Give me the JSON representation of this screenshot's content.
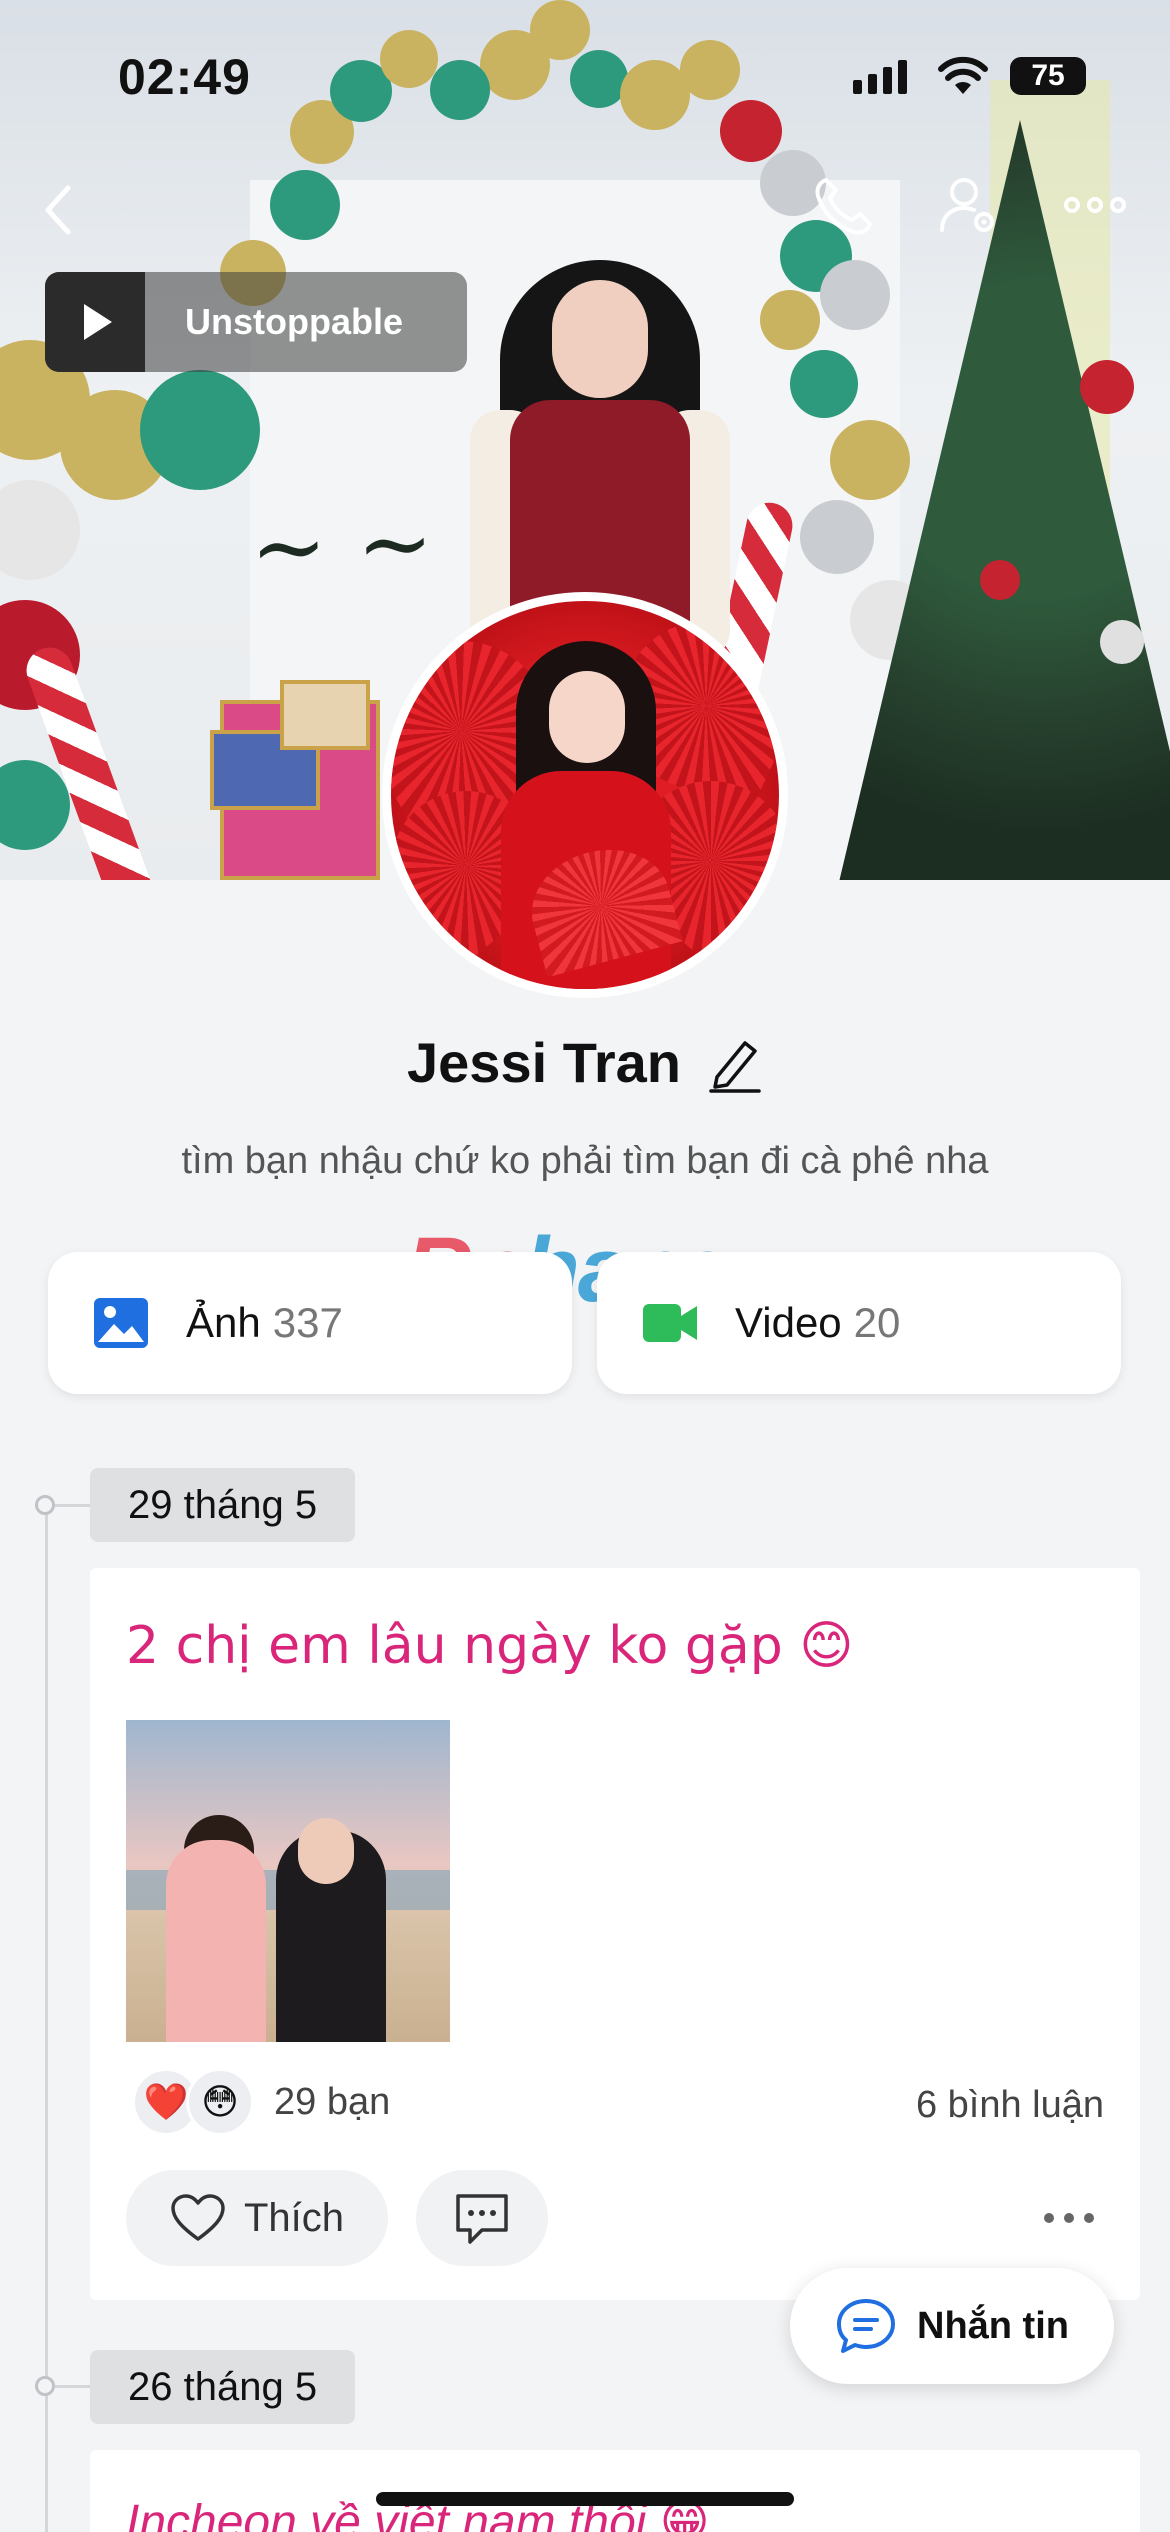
{
  "status_bar": {
    "time": "02:49",
    "battery": "75"
  },
  "cover": {
    "music_title": "Unstoppable"
  },
  "profile": {
    "name": "Jessi Tran",
    "bio": "tìm bạn nhậu chứ ko phải tìm bạn đi cà phê nha"
  },
  "watermark": {
    "part1": "Rp",
    "part2": "hang"
  },
  "media": {
    "photos": {
      "label": "Ảnh",
      "count": "337"
    },
    "videos": {
      "label": "Video",
      "count": "20"
    }
  },
  "timeline": [
    {
      "date": "29 tháng 5",
      "text": "2 chị em lâu ngày ko gặp 😊",
      "reactions": [
        "❤️",
        "😳"
      ],
      "reaction_count": "29 bạn",
      "comment_count": "6 bình luận",
      "like_label": "Thích"
    },
    {
      "date": "26 tháng 5",
      "text": "Incheon về việt nam thôi 😁"
    }
  ],
  "message_button": {
    "label": "Nhắn tin"
  },
  "colors": {
    "accent_pink": "#d9267b",
    "photo_icon": "#1f6fe0",
    "video_icon": "#2ebc5a",
    "message_icon": "#1f6fe0"
  },
  "icons": [
    "back-icon",
    "phone-icon",
    "user-settings-icon",
    "more-icon",
    "play-icon",
    "edit-icon",
    "photo-icon",
    "video-icon",
    "heart-icon",
    "comment-icon",
    "message-icon"
  ]
}
